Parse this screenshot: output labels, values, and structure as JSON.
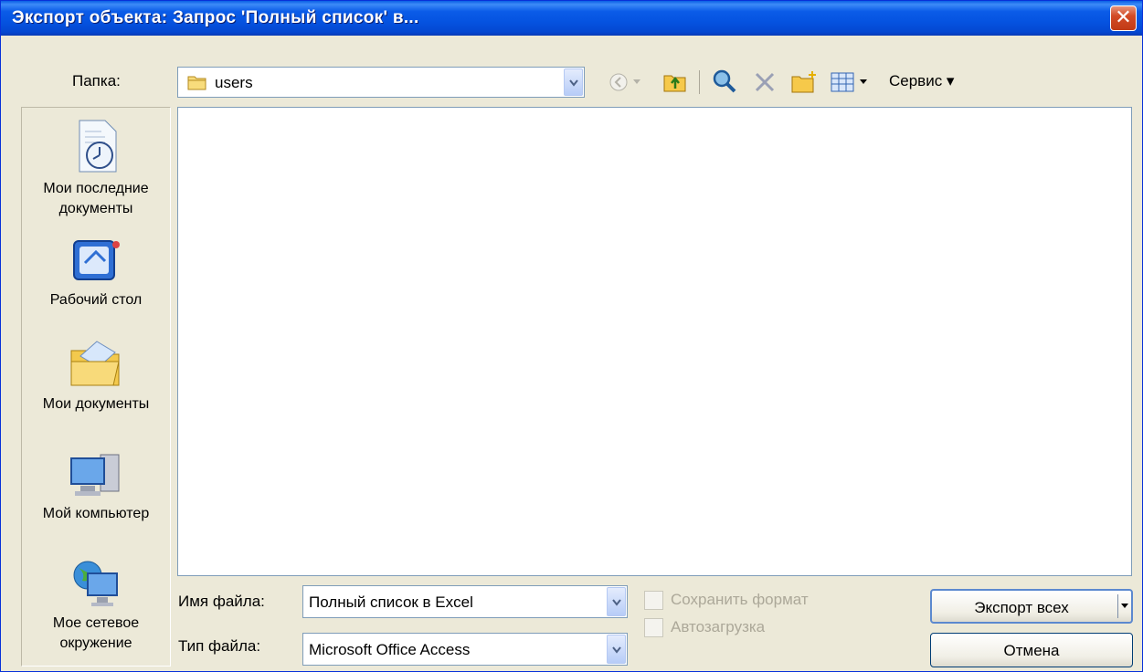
{
  "window": {
    "title": "Экспорт объекта: Запрос 'Полный список' в...",
    "close_glyph": "✕"
  },
  "toolbar": {
    "folder_label": "Папка:",
    "folder_value": "users",
    "service_label": "Сервис ▾",
    "icons": [
      "back-icon",
      "up-folder-icon",
      "search-web-icon",
      "delete-icon",
      "new-folder-icon",
      "views-icon"
    ]
  },
  "places": [
    {
      "label": "Мои последние документы",
      "icon": "recent-documents-icon"
    },
    {
      "label": "Рабочий стол",
      "icon": "desktop-icon"
    },
    {
      "label": "Мои документы",
      "icon": "my-documents-icon"
    },
    {
      "label": "Мой компьютер",
      "icon": "my-computer-icon"
    },
    {
      "label": "Мое сетевое окружение",
      "icon": "network-places-icon"
    }
  ],
  "form": {
    "filename_label": "Имя файла:",
    "filename_value": "Полный список в Excel",
    "filetype_label": "Тип файла:",
    "filetype_value": "Microsoft Office Access",
    "save_format_label": "Сохранить формат",
    "autostart_label": "Автозагрузка",
    "save_format_checked": false,
    "autostart_checked": false
  },
  "buttons": {
    "export_all": "Экспорт всех",
    "cancel": "Отмена"
  },
  "colors": {
    "title_bar": "#0553e0",
    "dialog_bg": "#ece9d8",
    "close_button": "#d24b26"
  }
}
